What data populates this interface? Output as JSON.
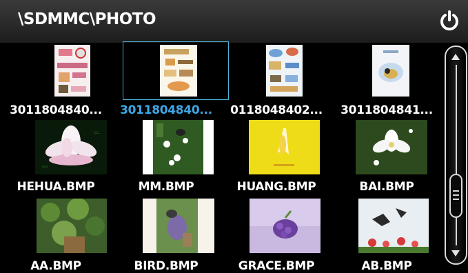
{
  "header": {
    "path": "\\SDMMC\\PHOTO",
    "power_icon": "power-icon"
  },
  "files": [
    {
      "name": "3011804840...",
      "selected": false,
      "icon": "photo-thumbnail"
    },
    {
      "name": "3011804840...",
      "selected": true,
      "icon": "photo-thumbnail"
    },
    {
      "name": "0118048402...",
      "selected": false,
      "icon": "photo-thumbnail"
    },
    {
      "name": "3011804841...",
      "selected": false,
      "icon": "photo-thumbnail"
    },
    {
      "name": "HEHUA.BMP",
      "selected": false,
      "icon": "photo-thumbnail"
    },
    {
      "name": "MM.BMP",
      "selected": false,
      "icon": "photo-thumbnail"
    },
    {
      "name": "HUANG.BMP",
      "selected": false,
      "icon": "photo-thumbnail"
    },
    {
      "name": "BAI.BMP",
      "selected": false,
      "icon": "photo-thumbnail"
    },
    {
      "name": "AA.BMP",
      "selected": false,
      "icon": "photo-thumbnail"
    },
    {
      "name": "BIRD.BMP",
      "selected": false,
      "icon": "photo-thumbnail"
    },
    {
      "name": "GRACE.BMP",
      "selected": false,
      "icon": "photo-thumbnail"
    },
    {
      "name": "AB.BMP",
      "selected": false,
      "icon": "photo-thumbnail"
    }
  ],
  "colors": {
    "selection": "#3ea8e6",
    "text": "#ffffff",
    "background": "#000000"
  }
}
